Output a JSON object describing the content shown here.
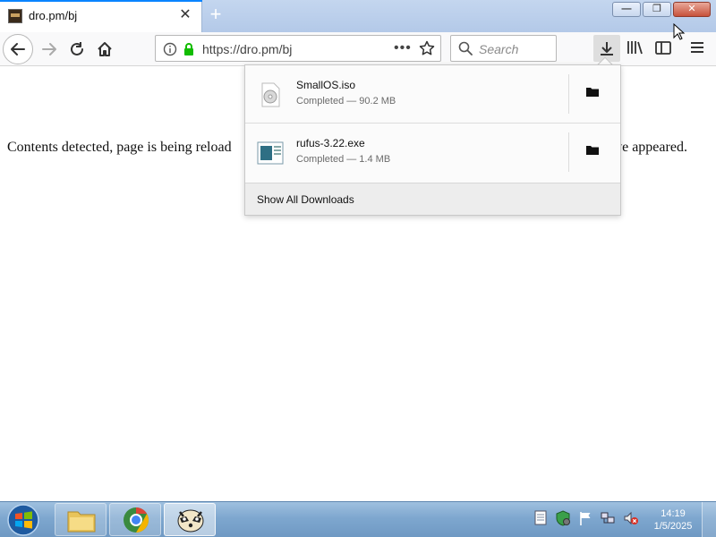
{
  "window": {
    "tab_title": "dro.pm/bj",
    "minimize_glyph": "—",
    "restore_glyph": "❐",
    "close_glyph": "✕"
  },
  "navbar": {
    "url": "https://dro.pm/bj",
    "url_more": "•••",
    "search_placeholder": "Search"
  },
  "page": {
    "text_left": "Contents detected, page is being reload",
    "text_right": "ave appeared."
  },
  "downloads": {
    "items": [
      {
        "name": "SmallOS.iso",
        "status": "Completed — 90.2 MB",
        "icon": "disc-image-icon"
      },
      {
        "name": "rufus-3.22.exe",
        "status": "Completed — 1.4 MB",
        "icon": "executable-icon"
      }
    ],
    "footer_label": "Show All Downloads"
  },
  "taskbar": {
    "time": "14:19",
    "date": "1/5/2025",
    "items": [
      "file-explorer",
      "chrome",
      "firefox-raccoon"
    ]
  },
  "colors": {
    "accent": "#0a84ff",
    "lock_green": "#12bc00",
    "taskbar_blue": "#7ea7cf"
  }
}
